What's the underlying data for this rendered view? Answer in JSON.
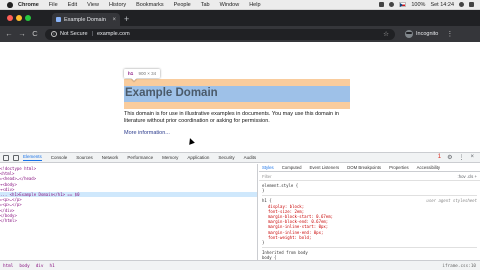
{
  "menubar": {
    "app_name": "Chrome",
    "items": [
      "File",
      "Edit",
      "View",
      "History",
      "Bookmarks",
      "People",
      "Tab",
      "Window",
      "Help"
    ],
    "battery": "100%",
    "clock": "Set 14:24"
  },
  "tab": {
    "title": "Example Domain",
    "close": "×",
    "new_tab": "+"
  },
  "toolbar": {
    "back": "←",
    "forward": "→",
    "reload": "C",
    "security_label": "Not Secure",
    "separator": "|",
    "url": "example.com",
    "star": "☆",
    "incognito_label": "Incognito",
    "menu": "⋮"
  },
  "page": {
    "tooltip_tag": "h1",
    "tooltip_dims": "900 × 34",
    "heading": "Example Domain",
    "paragraph": "This domain is for use in illustrative examples in documents. You may use this domain in literature without prior coordination or asking for permission.",
    "link": "More information..."
  },
  "devtools": {
    "tabs": [
      "Elements",
      "Console",
      "Sources",
      "Network",
      "Performance",
      "Memory",
      "Application",
      "Security",
      "Audits"
    ],
    "active_tab": "Elements",
    "error_badge": "1",
    "settings": "⚙",
    "more": "⋮",
    "close": "×",
    "dom_lines": [
      "<!doctype html>",
      "<html>",
      "  ▸<head>…</head>",
      "  ▾<body>",
      "    ▾<div>",
      "...     <h1>Example Domain</h1> == $0",
      "      ▸<p>…</p>",
      "      ▸<p>…</p>",
      "      </div>",
      "    </body>",
      "</html>"
    ],
    "selected_dom_index": 5,
    "side_tabs": [
      "Styles",
      "Computed",
      "Event Listeners",
      "DOM Breakpoints",
      "Properties",
      "Accessibility"
    ],
    "active_side_tab": "Styles",
    "filter_placeholder": "Filter",
    "filter_buttons": ":hov .cls +",
    "element_style": "element.style {",
    "element_style_close": "}",
    "rule_selector": "h1 {",
    "rule_source": "user agent stylesheet",
    "rule_props": [
      "display: block;",
      "font-size: 2em;",
      "margin-block-start: 0.67em;",
      "margin-block-end: 0.67em;",
      "margin-inline-start: 0px;",
      "margin-inline-end: 0px;",
      "font-weight: bold;"
    ],
    "rule_close": "}",
    "inherited_label": "Inherited from body",
    "body_selector": "body {",
    "breadcrumbs": [
      "html",
      "body",
      "div",
      "h1"
    ],
    "breadcrumb_right": "iframe.css:10"
  }
}
